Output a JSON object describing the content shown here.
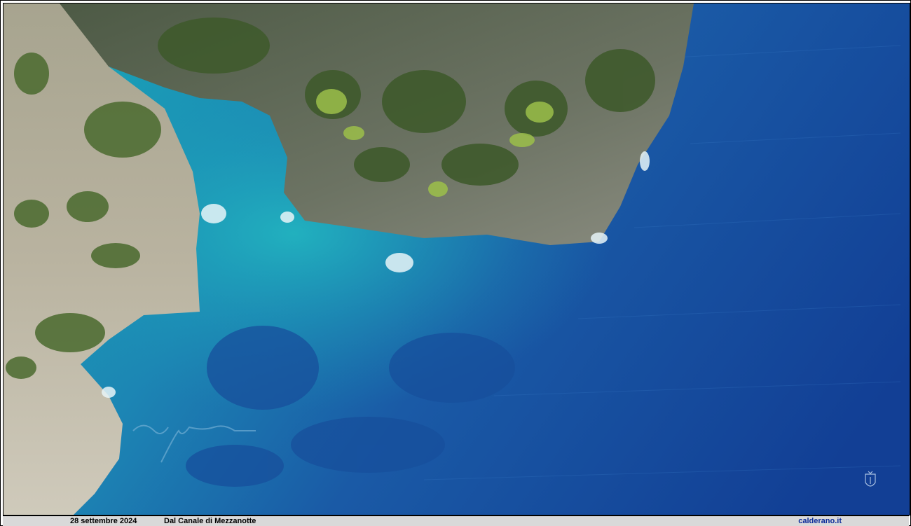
{
  "photo": {
    "subject": "aerial-coastline",
    "colors": {
      "deep_sea": "#123f95",
      "mid_sea": "#1d6bb0",
      "shallow_sea": "#1aa3b7",
      "rock": "#5f6a5c",
      "vegetation": "#3f5a2c",
      "cliff_light": "#b9b3a0"
    },
    "signature_icon": "handwritten-signature",
    "watermark_icon": "crest-icon"
  },
  "caption": {
    "date": "28 settembre 2024",
    "place": "Dal Canale di Mezzanotte",
    "site": "calderano.it"
  }
}
